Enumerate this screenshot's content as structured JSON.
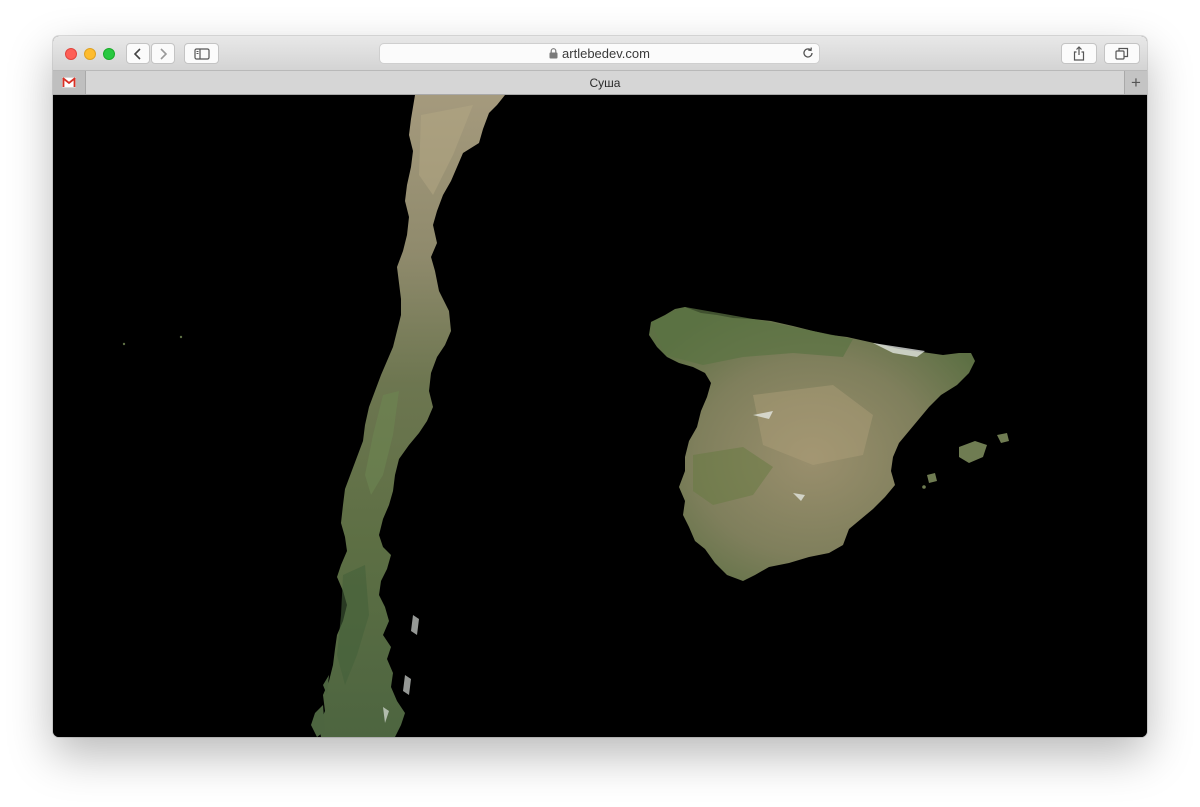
{
  "browser": {
    "url": "artlebedev.com",
    "tab_title": "Суша",
    "new_tab_label": "+"
  },
  "icons": {
    "back": "chevron-left-icon",
    "forward": "chevron-right-icon",
    "sidebar": "sidebar-icon",
    "lock": "lock-icon",
    "reload": "reload-icon",
    "share": "share-icon",
    "tabs": "tabs-overview-icon",
    "pinned": "gmail-icon"
  },
  "colors": {
    "background": "#000000",
    "land_green": "#5f7449",
    "land_tan": "#9c9070",
    "snow": "#e8ece8"
  },
  "map": {
    "landmasses": [
      "Chile",
      "Iberian Peninsula",
      "Balearic Islands"
    ]
  }
}
